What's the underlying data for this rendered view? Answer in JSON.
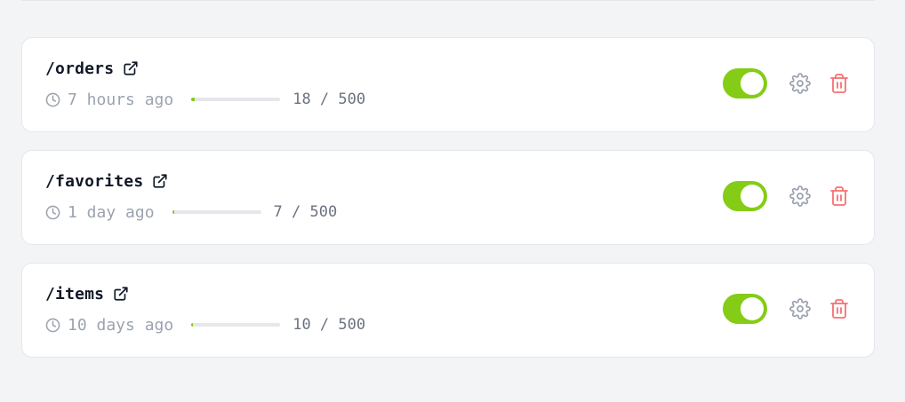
{
  "colors": {
    "accent": "#84cc16",
    "danger": "#f87171",
    "muted": "#9ca3af"
  },
  "endpoints": [
    {
      "path": "/orders",
      "last_seen": "7 hours ago",
      "usage_text": "18 / 500",
      "usage_used": 18,
      "usage_limit": 500,
      "enabled": true,
      "icons": [
        "external-link-icon",
        "clock-icon",
        "gear-icon",
        "trash-icon"
      ]
    },
    {
      "path": "/favorites",
      "last_seen": "1 day ago",
      "usage_text": "7 / 500",
      "usage_used": 7,
      "usage_limit": 500,
      "enabled": true,
      "icons": [
        "external-link-icon",
        "clock-icon",
        "gear-icon",
        "trash-icon"
      ]
    },
    {
      "path": "/items",
      "last_seen": "10 days ago",
      "usage_text": "10 / 500",
      "usage_used": 10,
      "usage_limit": 500,
      "enabled": true,
      "icons": [
        "external-link-icon",
        "clock-icon",
        "gear-icon",
        "trash-icon"
      ]
    }
  ]
}
